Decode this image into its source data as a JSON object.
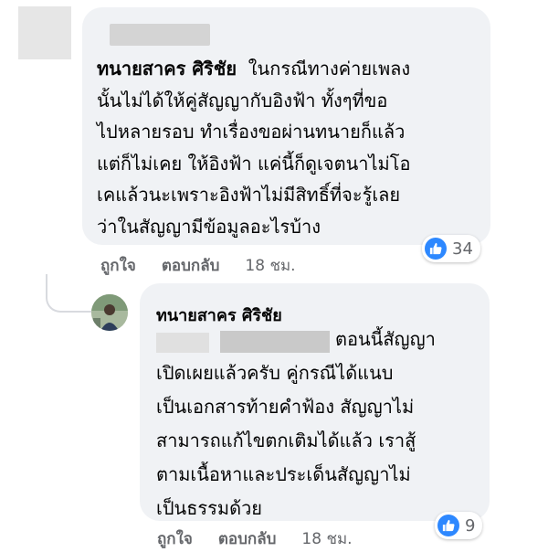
{
  "comment1": {
    "author": "ทนายสาคร ศิริชัย",
    "lines": [
      "ในกรณีทางค่ายเพลง",
      "นั้นไม่ได้ให้คู่สัญญากับอิงฟ้า ทั้งๆที่ขอ",
      "ไปหลายรอบ ทำเรื่องขอผ่านทนายก็แล้ว",
      "แต่ก็ไม่เคย ให้อิงฟ้า แค่นี้ก็ดูเจตนาไม่โอ",
      "เคแล้วนะเพราะอิงฟ้าไม่มีสิทธิ์ที่จะรู้เลย",
      "ว่าในสัญญามีข้อมูลอะไรบ้าง"
    ],
    "reaction_count": "34",
    "actions": {
      "like": "ถูกใจ",
      "reply": "ตอบกลับ",
      "time": "18 ชม."
    }
  },
  "comment2": {
    "author": "ทนายสาคร ศิริชัย",
    "lines": [
      "ตอนนี้สัญญา",
      "เปิดเผยแล้วครับ คู่กรณีได้แนบ",
      "เป็นเอกสารท้ายคำฟ้อง สัญญาไม่",
      "สามารถแก้ไขตกเติมได้แล้ว เราสู้",
      "ตามเนื้อหาและประเด็นสัญญาไม่",
      "เป็นธรรมด้วย"
    ],
    "reaction_count": "9",
    "actions": {
      "like": "ถูกใจ",
      "reply": "ตอบกลับ",
      "time": "18 ชม."
    }
  },
  "colors": {
    "like_blue": "#2d88ff",
    "bubble": "#f0f2f5",
    "meta": "#65676b"
  }
}
